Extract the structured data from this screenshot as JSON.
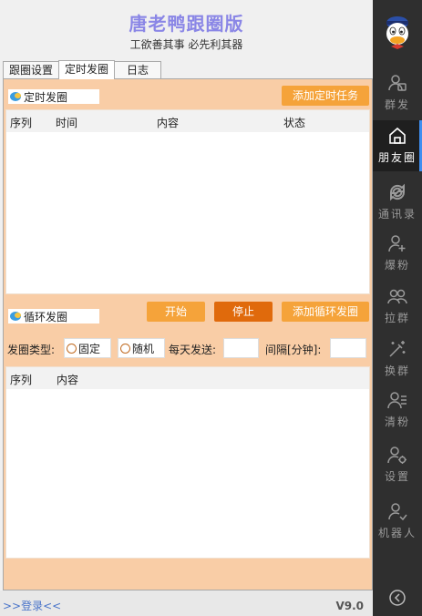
{
  "header": {
    "title": "唐老鸭跟圈版",
    "subtitle": "工欲善其事 必先利其器"
  },
  "tabs": [
    {
      "label": "跟圈设置"
    },
    {
      "label": "定时发圈"
    },
    {
      "label": "日志"
    }
  ],
  "scheduled": {
    "section_label": "定时发圈",
    "add_button": "添加定时任务",
    "columns": [
      "序列",
      "时间",
      "内容",
      "状态"
    ]
  },
  "loop": {
    "section_label": "循环发圈",
    "start_button": "开始",
    "stop_button": "停止",
    "add_button": "添加循环发圈",
    "type_label": "发圈类型:",
    "type_options": [
      "固定",
      "随机"
    ],
    "daily_label": "每天发送:",
    "daily_value": "",
    "interval_label": "间隔[分钟]:",
    "interval_value": "",
    "columns": [
      "序列",
      "内容"
    ]
  },
  "footer": {
    "login_text": ">>登录<<",
    "version": "V9.0"
  },
  "sidebar": {
    "items": [
      {
        "label": "群发",
        "icon": "group-send-icon"
      },
      {
        "label": "朋友圈",
        "icon": "home-icon"
      },
      {
        "label": "通讯录",
        "icon": "refresh-icon"
      },
      {
        "label": "爆粉",
        "icon": "add-user-icon"
      },
      {
        "label": "拉群",
        "icon": "pull-group-icon"
      },
      {
        "label": "换群",
        "icon": "magic-icon"
      },
      {
        "label": "清粉",
        "icon": "clear-user-icon"
      },
      {
        "label": "设置",
        "icon": "user-settings-icon"
      },
      {
        "label": "机器人",
        "icon": "robot-user-icon"
      }
    ],
    "active_index": 1
  },
  "colors": {
    "panel_bg": "#f9cda6",
    "button_orange": "#f5a33a",
    "button_dark": "#e06a0c",
    "title_color": "#8a86e6",
    "sidebar_bg": "#2f2f2f",
    "active_indicator": "#3f8ef0"
  }
}
